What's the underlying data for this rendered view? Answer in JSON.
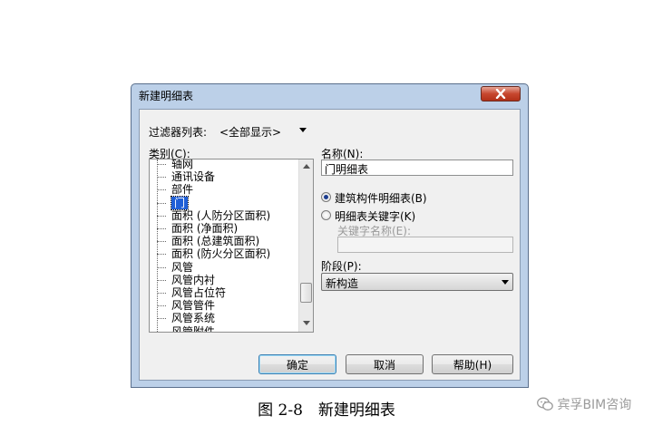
{
  "dialog": {
    "title": "新建明细表",
    "filter_label": "过滤器列表:",
    "filter_value": "<全部显示>",
    "category_label": "类别(C):",
    "categories": [
      {
        "label": "轴网",
        "selected": false
      },
      {
        "label": "通讯设备",
        "selected": false
      },
      {
        "label": "部件",
        "selected": false
      },
      {
        "label": "门",
        "selected": true
      },
      {
        "label": "面积 (人防分区面积)",
        "selected": false
      },
      {
        "label": "面积 (净面积)",
        "selected": false
      },
      {
        "label": "面积 (总建筑面积)",
        "selected": false
      },
      {
        "label": "面积 (防火分区面积)",
        "selected": false
      },
      {
        "label": "风管",
        "selected": false
      },
      {
        "label": "风管内衬",
        "selected": false
      },
      {
        "label": "风管占位符",
        "selected": false
      },
      {
        "label": "风管管件",
        "selected": false
      },
      {
        "label": "风管系统",
        "selected": false
      },
      {
        "label": "风管附件",
        "selected": false
      }
    ],
    "name_label": "名称(N):",
    "name_value": "门明细表",
    "radio_building": "建筑构件明细表(B)",
    "radio_key": "明细表关键字(K)",
    "key_name_label": "关键字名称(E):",
    "key_name_value": "",
    "phase_label": "阶段(P):",
    "phase_value": "新构造",
    "ok_label": "确定",
    "cancel_label": "取消",
    "help_label": "帮助(H)"
  },
  "caption": "图 2-8　新建明细表",
  "watermark": "宾孚BIM咨询",
  "colors": {
    "selection": "#1f5fd6",
    "title_bar": "#bcd0e8",
    "close_button": "#c7472f"
  }
}
